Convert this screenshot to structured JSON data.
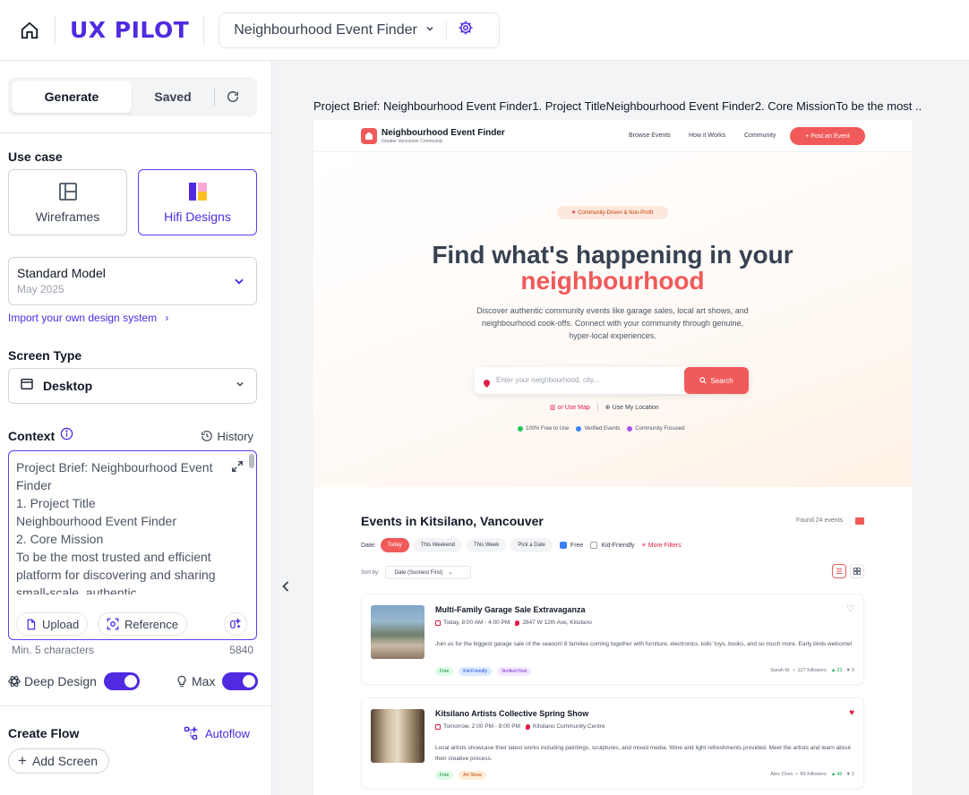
{
  "topbar": {
    "logo": "UX PILOT",
    "project": "Neighbourhood Event Finder"
  },
  "sidebar": {
    "tabs": {
      "generate": "Generate",
      "saved": "Saved"
    },
    "use_case": {
      "label": "Use case",
      "options": [
        {
          "label": "Wireframes",
          "icon": "layout-icon",
          "selected": false
        },
        {
          "label": "Hifi Designs",
          "icon": "hifi-icon",
          "selected": true
        }
      ]
    },
    "model": {
      "name": "Standard Model",
      "date": "May 2025"
    },
    "import_link": "Import your own design system",
    "screen_type": {
      "label": "Screen Type",
      "value": "Desktop"
    },
    "context": {
      "label": "Context",
      "history": "History",
      "text": "Project Brief: Neighbourhood Event Finder\n1. Project Title\nNeighbourhood Event Finder\n2. Core Mission\nTo be the most trusted and efficient platform for discovering and sharing small-scale, authentic",
      "upload": "Upload",
      "reference": "Reference",
      "min_chars": "Min. 5 characters",
      "char_count": "5840"
    },
    "toggles": {
      "deep_design": "Deep Design",
      "deep_design_on": true,
      "max": "Max",
      "max_on": true
    },
    "create_flow": {
      "label": "Create Flow",
      "autoflow": "Autoflow",
      "add_screen": "Add Screen"
    }
  },
  "canvas": {
    "brief_title": "Project Brief: Neighbourhood Event Finder1. Project TitleNeighbourhood Event Finder2. Core MissionTo be the most ...",
    "preview": {
      "brand": "Neighbourhood Event Finder",
      "brand_sub": "Greater Vancouver Community",
      "nav": [
        "Browse Events",
        "How it Works",
        "Community"
      ],
      "post_button": "+ Post an Event",
      "badge": "Community-Driven & Non-Profit",
      "headline_1": "Find what's happening in your",
      "headline_2": "neighbourhood",
      "description": "Discover authentic community events like garage sales, local art shows, and neighbourhood cook-offs. Connect with your community through genuine, hyper-local experiences.",
      "search_placeholder": "Enter your neighbourhood, city...",
      "search_button": "Search",
      "or_use_map": "or Use Map",
      "use_location": "Use My Location",
      "features": [
        "100% Free to Use",
        "Verified Events",
        "Community Focused"
      ],
      "events_title": "Events in Kitsilano, Vancouver",
      "found": "Found 24 events",
      "date_label": "Date:",
      "date_filters": [
        "Today",
        "This Weekend",
        "This Week",
        "Pick a Date"
      ],
      "free": "Free",
      "kid_friendly": "Kid-Friendly",
      "more_filters": "More Filters",
      "sort_label": "Sort by:",
      "sort_value": "Date (Soonest First)",
      "events": [
        {
          "title": "Multi-Family Garage Sale Extravaganza",
          "time": "Today, 8:00 AM - 4:00 PM",
          "location": "2847 W 12th Ave, Kitsilano",
          "description": "Join us for the biggest garage sale of the season! 8 families coming together with furniture, electronics, kids' toys, books, and so much more. Early birds welcome!",
          "tags": [
            "Free",
            "Kid-Friendly",
            "Verified Host"
          ],
          "host": "Sarah M.",
          "followers": "127 followers",
          "up": "23",
          "down": "0",
          "liked": false
        },
        {
          "title": "Kitsilano Artists Collective Spring Show",
          "time": "Tomorrow, 2:00 PM - 8:00 PM",
          "location": "Kitsilano Community Centre",
          "description": "Local artists showcase their latest works including paintings, sculptures, and mixed media. Wine and light refreshments provided. Meet the artists and learn about their creative process.",
          "tags": [
            "Free",
            "Art Show"
          ],
          "host": "Alex Chen",
          "followers": "89 followers",
          "up": "45",
          "down": "1",
          "liked": true
        }
      ]
    }
  },
  "colors": {
    "accent": "#4f2ae0",
    "preview_accent": "#f05a5a"
  }
}
